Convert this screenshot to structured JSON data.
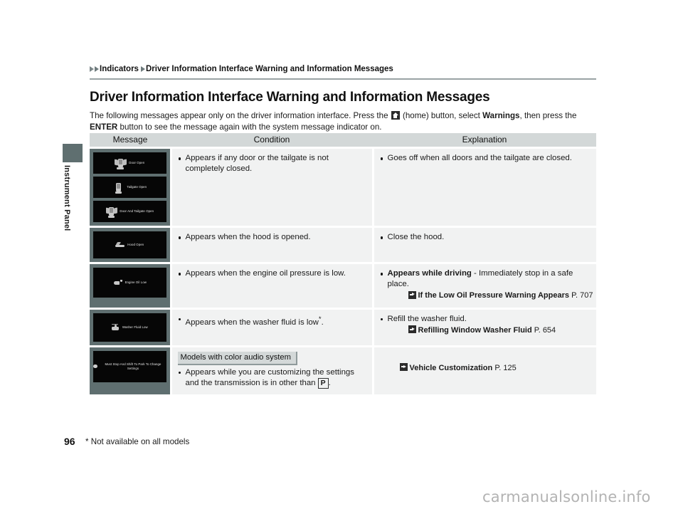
{
  "sidebar": {
    "section_label": "Instrument Panel"
  },
  "breadcrumb": {
    "item1": "Indicators",
    "item2": "Driver Information Interface Warning and Information Messages"
  },
  "page_title": "Driver Information Interface Warning and Information Messages",
  "intro": {
    "part1": "The following messages appear only on the driver information interface. Press the ",
    "home_icon": "home-icon",
    "part2": " (home) button, select ",
    "warnings": "Warnings",
    "part3": ", then press the ",
    "enter": "ENTER",
    "part4": " button to see the message again with the system message indicator on."
  },
  "table": {
    "headers": {
      "message": "Message",
      "condition": "Condition",
      "explanation": "Explanation"
    },
    "rows": [
      {
        "screens": [
          {
            "text": "Door Open",
            "glyph": "vehicle-doors-open-icon"
          },
          {
            "text": "Tailgate Open",
            "glyph": "vehicle-tailgate-open-icon"
          },
          {
            "text": "Door And Tailgate Open",
            "glyph": "vehicle-door-and-tailgate-open-icon"
          }
        ],
        "condition": "Appears if any door or the tailgate is not completely closed.",
        "explanation": "Goes off when all doors and the tailgate are closed."
      },
      {
        "screens": [
          {
            "text": "Hood Open",
            "glyph": "hood-open-icon"
          }
        ],
        "condition": "Appears when the hood is opened.",
        "explanation": "Close the hood."
      },
      {
        "screens": [
          {
            "text": "Engine Oil Low",
            "glyph": "oil-can-icon"
          }
        ],
        "condition": "Appears when the engine oil pressure is low.",
        "explanation_bold": "Appears while driving",
        "explanation_rest": " - Immediately stop in a safe place.",
        "reference": {
          "title": "If the Low Oil Pressure Warning Appears",
          "page": "P. 707"
        }
      },
      {
        "screens": [
          {
            "text": "Washer Fluid Low",
            "glyph": "washer-fluid-icon"
          }
        ],
        "condition": "Appears when the washer fluid is low",
        "condition_footnote": "*",
        "condition_end": ".",
        "explanation": "Refill the washer fluid.",
        "reference": {
          "title": "Refilling Window Washer Fluid",
          "page": "P. 654"
        }
      },
      {
        "screens": [
          {
            "text": "Must Stop And Shift To Park To Change Settings",
            "glyph": "warning-dot-icon"
          }
        ],
        "badge": "Models with color audio system",
        "condition_a": "Appears while you are customizing the settings and the transmission is in other than ",
        "condition_gear": "P",
        "condition_b": ".",
        "reference": {
          "title": "Vehicle Customization",
          "page": "P. 125"
        }
      }
    ]
  },
  "footer": {
    "page_number": "96",
    "footnote": "* Not available on all models",
    "watermark": "carmanualsonline.info"
  }
}
